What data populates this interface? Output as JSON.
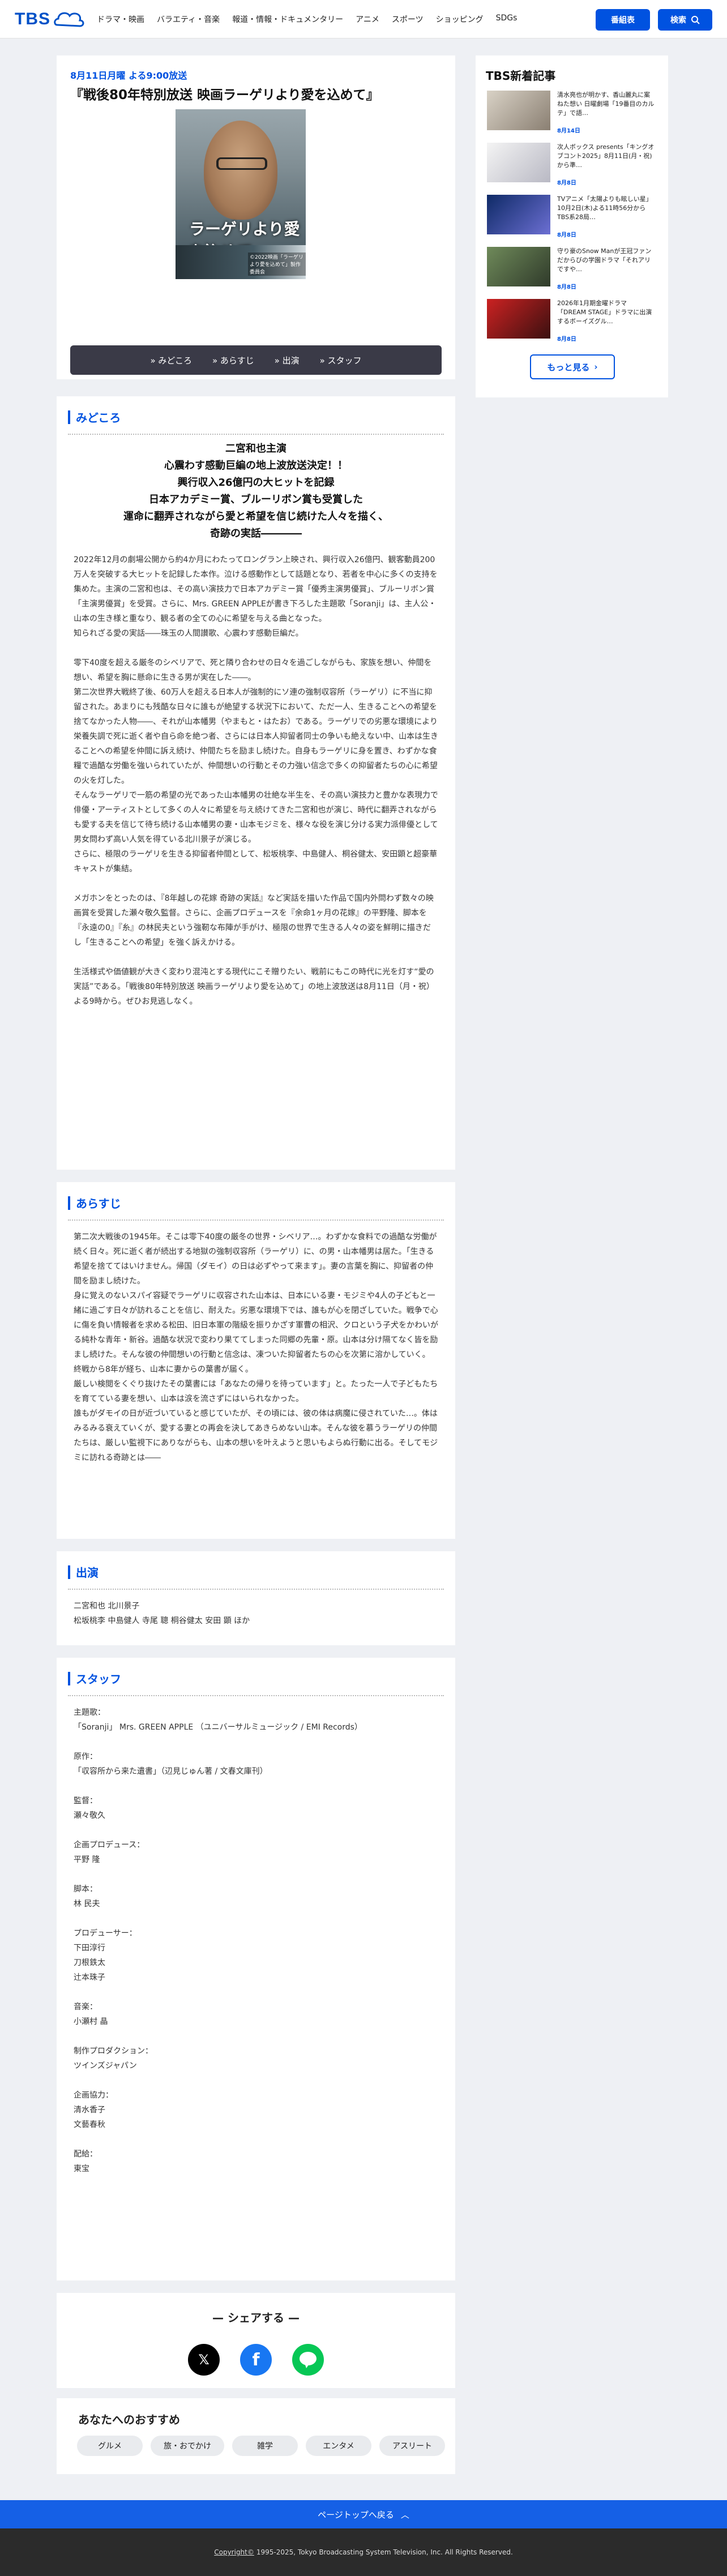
{
  "header": {
    "logo": "TBS",
    "nav": [
      "ドラマ・映画",
      "バラエティ・音楽",
      "報道・情報・ドキュメンタリー",
      "アニメ",
      "スポーツ",
      "ショッピング",
      "SDGs"
    ],
    "program_button": "番組表",
    "search_button": "検索"
  },
  "main": {
    "date": "8月11日月曜 よる9:00放送",
    "title": "『戦後80年特別放送 映画ラーゲリより愛を込めて』",
    "poster_title": "ラーゲリより愛を込めて",
    "poster_copyright": "©2022映画「ラーゲリより愛を込めて」製作委員会",
    "tabs": [
      "» みどころ",
      "» あらすじ",
      "» 出演",
      "» スタッフ"
    ]
  },
  "sidebar": {
    "title": "TBS新着記事",
    "items": [
      {
        "text": "清水亮也が明かす、香山麗丸に案ねた想い 日曜劇場「19番目のカルテ」で語…",
        "date": "8月14日"
      },
      {
        "text": "次人ボックス presents「キングオブコント2025」8月11日(月・祝)から準…",
        "date": "8月8日"
      },
      {
        "text": "TVアニメ「太陽よりも眩しい星」10月2日(木)よる11時56分からTBS系28局…",
        "date": "8月8日"
      },
      {
        "text": "守り豪のSnow Manが王冠ファンだからびの学園ドラマ「それアリですや…",
        "date": "8月8日"
      },
      {
        "text": "2026年1月期金曜ドラマ「DREAM STAGE」ドラマに出演するボーイズグル…",
        "date": "8月8日"
      }
    ],
    "more": "もっと見る"
  },
  "midokoro": {
    "heading": "みどころ",
    "lead": [
      "二宮和也主演",
      "心震わす感動巨編の地上波放送決定！！",
      "興行収入26億円の大ヒットを記録",
      "日本アカデミー賞、ブルーリボン賞も受賞した",
      "運命に翻弄されながら愛と希望を信じ続けた人々を描く、",
      "奇跡の実話――――"
    ],
    "paras": [
      "2022年12月の劇場公開から約4か月にわたってロングラン上映され、興行収入26億円、観客動員200万人を突破する大ヒットを記録した本作。泣ける感動作として話題となり、若者を中心に多くの支持を集めた。主演の二宮和也は、その高い演技力で日本アカデミー賞「優秀主演男優賞」、ブルーリボン賞「主演男優賞」を受賞。さらに、Mrs. GREEN APPLEが書き下ろした主題歌「Soranji」は、主人公・山本の生き様と重なり、観る者の全ての心に希望を与える曲となった。",
      "知られざる愛の実話――珠玉の人間讃歌、心震わす感動巨編だ。",
      "",
      "零下40度を超える厳冬のシベリアで、死と隣り合わせの日々を過ごしながらも、家族を想い、仲間を想い、希望を胸に懸命に生きる男が実在した――。",
      "第二次世界大戦終了後、60万人を超える日本人が強制的にソ連の強制収容所（ラーゲリ）に不当に抑留された。あまりにも残酷な日々に誰もが絶望する状況下において、ただ一人、生きることへの希望を捨てなかった人物――、それが山本幡男（やまもと・はたお）である。ラーゲリでの劣悪な環境により栄養失調で死に逝く者や自ら命を絶つ者、さらには日本人抑留者同士の争いも絶えない中、山本は生きることへの希望を仲間に訴え続け、仲間たちを励まし続けた。自身もラーゲリに身を置き、わずかな食糧で過酷な労働を強いられていたが、仲間想いの行動とその力強い信念で多くの抑留者たちの心に希望の火を灯した。",
      "そんなラーゲリで一筋の希望の光であった山本幡男の壮絶な半生を、その高い演技力と豊かな表現力で俳優・アーティストとして多くの人々に希望を与え続けてきた二宮和也が演じ、時代に翻弄されながらも愛する夫を信じて待ち続ける山本幡男の妻・山本モジミを、様々な役を演じ分ける実力派俳優として男女問わず高い人気を得ている北川景子が演じる。",
      "さらに、極限のラーゲリを生きる抑留者仲間として、松坂桃李、中島健人、桐谷健太、安田顕と超豪華キャストが集結。",
      "",
      "メガホンをとったのは、『8年越しの花嫁 奇跡の実話』など実話を描いた作品で国内外問わず数々の映画賞を受賞した瀬々敬久監督。さらに、企画プロデュースを『余命1ヶ月の花嫁』の平野隆、脚本を『永遠の0』『糸』の林民夫という強靭な布陣が手がけ、極限の世界で生きる人々の姿を鮮明に描きだし「生きることへの希望」を強く訴えかける。",
      "",
      "生活様式や価値観が大きく変わり混沌とする現代にこそ贈りたい、戦前にもこの時代に光を灯す“愛の実話”である。「戦後80年特別放送 映画ラーゲリより愛を込めて」の地上波放送は8月11日（月・祝）よる9時から。ぜひお見逃しなく。"
    ]
  },
  "arasuji": {
    "heading": "あらすじ",
    "paras": [
      "第二次大戦後の1945年。そこは零下40度の厳冬の世界・シベリア…。わずかな食料での過酷な労働が続く日々。死に逝く者が続出する地獄の強制収容所（ラーゲリ）に、の男・山本幡男は居た。「生きる希望を捨ててはいけません。帰国（ダモイ）の日は必ずやって来ます」。妻の言葉を胸に、抑留者の仲間を励まし続けた。",
      "身に覚えのないスパイ容疑でラーゲリに収容された山本は、日本にいる妻・モジミや4人の子どもと一緒に過ごす日々が訪れることを信じ、耐えた。劣悪な環境下では、誰もが心を閉ざしていた。戦争で心に傷を負い情報者を求める松田、旧日本軍の階級を振りかざす軍曹の相沢、クロという子犬をかわいがる純朴な青年・新谷。過酷な状況で変わり果ててしまった同郷の先輩・原。山本は分け隔てなく皆を励まし続けた。そんな彼の仲間想いの行動と信念は、凍ついた抑留者たちの心を次第に溶かしていく。",
      "終戦から8年が経ち、山本に妻からの葉書が届く。",
      "厳しい検閲をくぐり抜けたその葉書には「あなたの帰りを待っています」と。たった一人で子どもたちを育てている妻を想い、山本は涙を流さずにはいられなかった。",
      "誰もがダモイの日が近づいていると感じていたが、その頃には、彼の体は病魔に侵されていた…。体はみるみる衰えていくが、愛する妻との再会を決してあきらめない山本。そんな彼を慕うラーゲリの仲間たちは、厳しい監視下にありながらも、山本の想いを叶えようと思いもよらぬ行動に出る。そしてモジミに訪れる奇跡とは――"
    ]
  },
  "cast": {
    "heading": "出演",
    "lines": [
      "二宮和也 北川景子",
      "松坂桃李 中島健人 寺尾 聰 桐谷健太 安田 顕 ほか"
    ]
  },
  "staff": {
    "heading": "スタッフ",
    "items": [
      {
        "label": "主題歌：",
        "value": "「Soranji」 Mrs. GREEN APPLE （ユニバーサルミュージック / EMI Records）"
      },
      {
        "label": "原作：",
        "value": "「収容所から来た遺書」（辺見じゅん著 / 文春文庫刊）"
      },
      {
        "label": "監督：",
        "value": "瀬々敬久"
      },
      {
        "label": "企画プロデュース：",
        "value": "平野 隆"
      },
      {
        "label": "脚本：",
        "value": "林 民夫"
      },
      {
        "label": "プロデューサー：",
        "value": "下田淳行\n刀根鉄太\n辻本珠子"
      },
      {
        "label": "音楽：",
        "value": "小瀬村 晶"
      },
      {
        "label": "制作プロダクション：",
        "value": "ツインズジャパン"
      },
      {
        "label": "企画協力：",
        "value": "清水香子\n文藝春秋"
      },
      {
        "label": "配給：",
        "value": "東宝"
      }
    ]
  },
  "share": {
    "title": "シェアする"
  },
  "recommend": {
    "title": "あなたへのおすすめ",
    "chips": [
      "グルメ",
      "旅・おでかけ",
      "雑学",
      "エンタメ",
      "アスリート"
    ]
  },
  "pagetop": "ページトップへ戻る",
  "footer": {
    "copyright_link": "Copyright©",
    "copyright_text": "1995-2025, Tokyo Broadcasting System Television, Inc. All Rights Reserved."
  },
  "colors": {
    "brand": "#0052e0",
    "line": "#06c755",
    "facebook": "#1877f2",
    "x": "#000000"
  }
}
